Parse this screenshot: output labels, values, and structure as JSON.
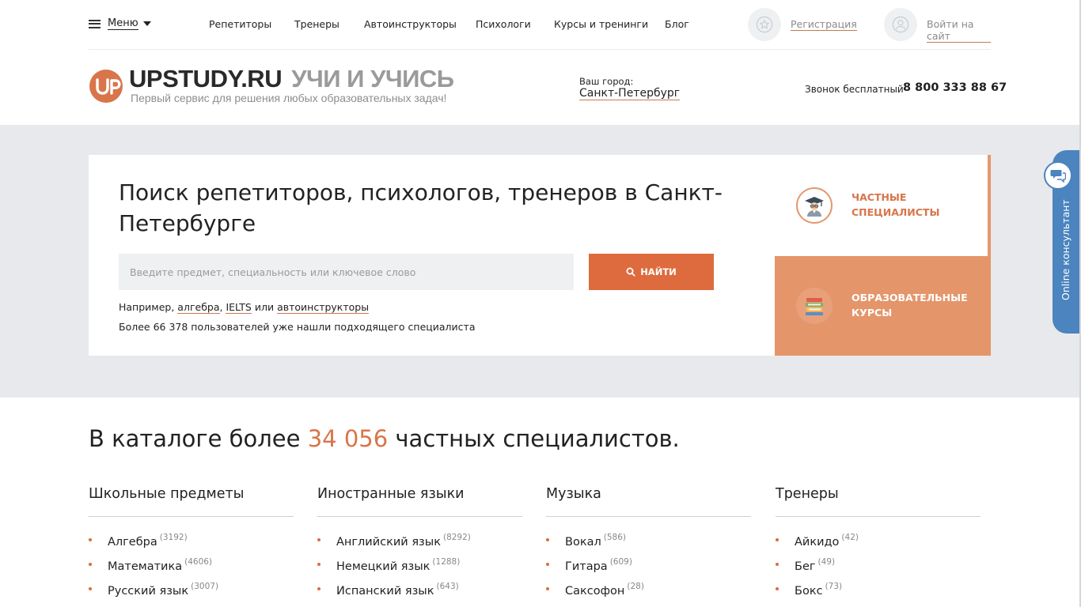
{
  "nav": {
    "menu_label": "Меню",
    "links": [
      "Репетиторы",
      "Тренеры",
      "Автоинструкторы",
      "Психологи",
      "Курсы и тренинги",
      "Блог"
    ],
    "register_label": "Регистрация",
    "login_label": "Войти на сайт"
  },
  "brand": {
    "name": "UPSTUDY.RU",
    "tagline": "УЧИ И УЧИСЬ",
    "subtitle": "Первый сервис для решения любых образовательных задач!"
  },
  "city": {
    "label": "Ваш город:",
    "value": "Санкт-Петербург"
  },
  "phone": {
    "label": "Звонок бесплатный",
    "number": "8 800 333 88 67"
  },
  "hero": {
    "title": "Поиск репетиторов, психологов, тренеров в Санкт-Петербурге",
    "search_placeholder": "Введите предмет, специальность или ключевое слово",
    "search_button": "НАЙТИ",
    "examples_prefix": "Например, ",
    "example_1": "алгебра",
    "example_sep": ", ",
    "example_2": "IELTS",
    "example_or": " или ",
    "example_3": "автоинструкторы",
    "users_note": "Более 66 378 пользователей уже нашли подходящего специалиста"
  },
  "tabs": {
    "private_label": "Частные специалисты",
    "courses_label": "Образовательные курсы"
  },
  "consultant": {
    "label": "Online консультант"
  },
  "catalog": {
    "title_prefix": "В каталоге более ",
    "count": "34 056",
    "title_suffix": " частных специалистов.",
    "columns": [
      {
        "title": "Школьные предметы",
        "items": [
          {
            "name": "Алгебра",
            "count": "(3192)"
          },
          {
            "name": "Математика",
            "count": "(4606)"
          },
          {
            "name": "Русский язык",
            "count": "(3007)"
          }
        ]
      },
      {
        "title": "Иностранные языки",
        "items": [
          {
            "name": "Английский язык",
            "count": "(8292)"
          },
          {
            "name": "Немецкий язык",
            "count": "(1288)"
          },
          {
            "name": "Испанский язык",
            "count": "(643)"
          }
        ]
      },
      {
        "title": "Музыка",
        "items": [
          {
            "name": "Вокал",
            "count": "(586)"
          },
          {
            "name": "Гитара",
            "count": "(609)"
          },
          {
            "name": "Саксофон",
            "count": "(28)"
          }
        ]
      },
      {
        "title": "Тренеры",
        "items": [
          {
            "name": "Айкидо",
            "count": "(42)"
          },
          {
            "name": "Бег",
            "count": "(49)"
          },
          {
            "name": "Бокс",
            "count": "(73)"
          }
        ]
      }
    ]
  },
  "colors": {
    "accent": "#dd6b3d",
    "accent_light": "#e4956a",
    "hero_bg": "#e8e9ec",
    "consultant": "#4b84be"
  },
  "icons": {
    "menu": "hamburger-icon",
    "register": "star-icon",
    "login": "user-icon",
    "search": "search-icon",
    "private": "graduate-icon",
    "courses": "books-icon",
    "consultant": "chat-icon"
  }
}
